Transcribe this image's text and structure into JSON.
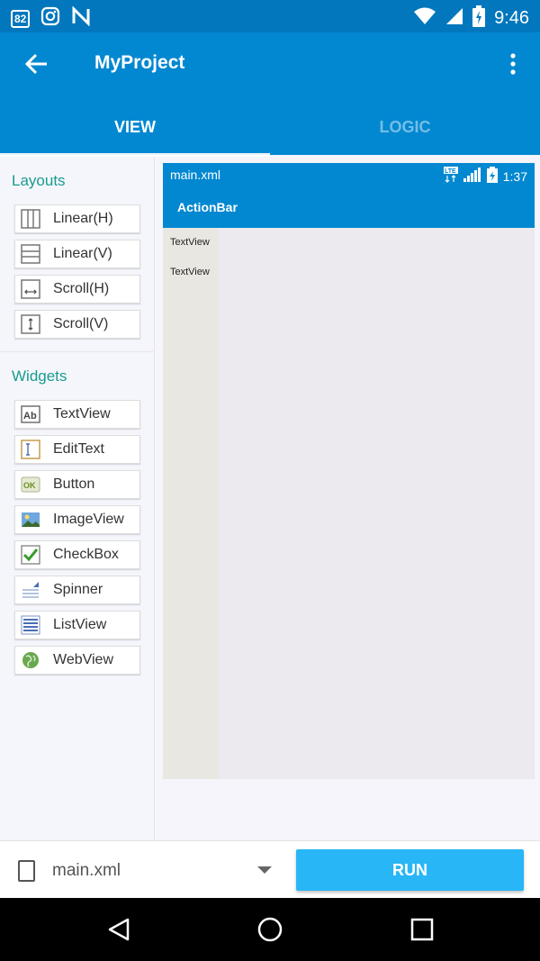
{
  "status_bar": {
    "battery_badge": "82",
    "time": "9:46",
    "icons": [
      "battery-badge-icon",
      "instagram-icon",
      "n-icon",
      "wifi-icon",
      "signal-icon",
      "battery-charging-icon"
    ]
  },
  "app_bar": {
    "title": "MyProject",
    "tabs": [
      {
        "label": "VIEW",
        "active": true
      },
      {
        "label": "LOGIC",
        "active": false
      }
    ]
  },
  "palette": {
    "layouts_title": "Layouts",
    "layouts": [
      {
        "label": "Linear(H)",
        "icon": "linear-h-icon"
      },
      {
        "label": "Linear(V)",
        "icon": "linear-v-icon"
      },
      {
        "label": "Scroll(H)",
        "icon": "scroll-h-icon"
      },
      {
        "label": "Scroll(V)",
        "icon": "scroll-v-icon"
      }
    ],
    "widgets_title": "Widgets",
    "widgets": [
      {
        "label": "TextView",
        "icon": "textview-icon"
      },
      {
        "label": "EditText",
        "icon": "edittext-icon"
      },
      {
        "label": "Button",
        "icon": "button-icon"
      },
      {
        "label": "ImageView",
        "icon": "imageview-icon"
      },
      {
        "label": "CheckBox",
        "icon": "checkbox-icon"
      },
      {
        "label": "Spinner",
        "icon": "spinner-icon"
      },
      {
        "label": "ListView",
        "icon": "listview-icon"
      },
      {
        "label": "WebView",
        "icon": "webview-icon"
      }
    ]
  },
  "preview": {
    "file_name": "main.xml",
    "time": "1:37",
    "network_label": "LTE",
    "actionbar_title": "ActionBar",
    "textviews": [
      "TextView",
      "TextView"
    ]
  },
  "bottom_bar": {
    "file_select": "main.xml",
    "run_label": "RUN"
  },
  "colors": {
    "primary": "#0288d1",
    "primary_dark": "#0277bd",
    "accent": "#29b6f6",
    "section_title": "#1a9b8f"
  }
}
